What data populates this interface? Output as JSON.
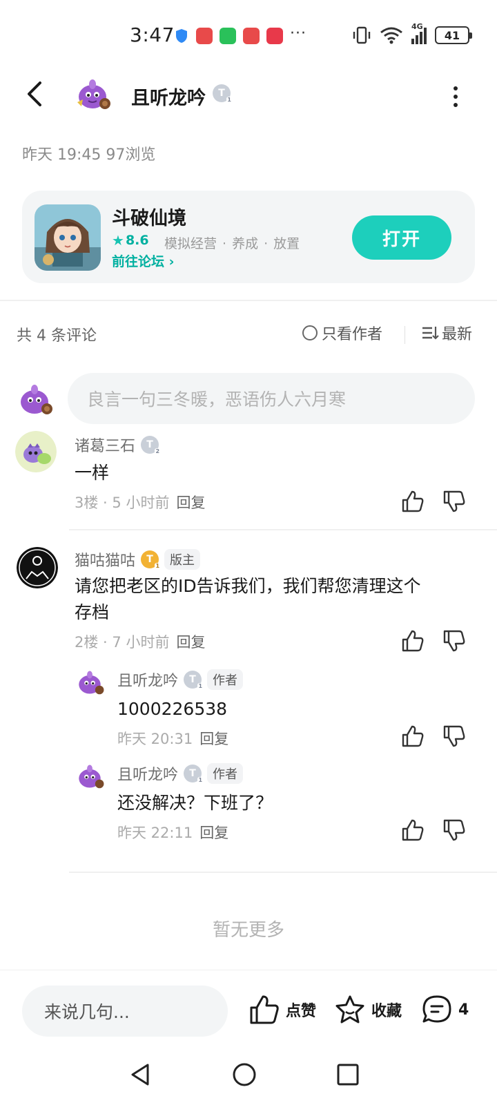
{
  "status_bar": {
    "time": "3:47",
    "battery": "41",
    "network": "4G",
    "more": "···"
  },
  "header": {
    "username": "且听龙吟",
    "level": "T"
  },
  "post_meta": "昨天 19:45  97浏览",
  "app_card": {
    "title": "斗破仙境",
    "rating": "8.6",
    "tags": [
      "模拟经营",
      "养成",
      "放置"
    ],
    "forum_link": "前往论坛",
    "open_label": "打开"
  },
  "comments_header": {
    "count": "共 4 条评论",
    "only_author": "只看作者",
    "sort": "最新"
  },
  "comment_input_placeholder": "良言一句三冬暖，恶语伤人六月寒",
  "comments": [
    {
      "name": "诸葛三石",
      "level": "T",
      "body": "一样",
      "floor": "3楼",
      "time": "5 小时前",
      "reply_label": "回复"
    },
    {
      "name": "猫咕猫咕",
      "level": "T",
      "role": "版主",
      "body_line1": "请您把老区的ID告诉我们，我们帮您清理这个",
      "body_line2": "存档",
      "floor": "2楼",
      "time": "7 小时前",
      "reply_label": "回复",
      "replies": [
        {
          "name": "且听龙吟",
          "level": "T",
          "role": "作者",
          "body": "1000226538",
          "time": "昨天 20:31",
          "reply_label": "回复"
        },
        {
          "name": "且听龙吟",
          "level": "T",
          "role": "作者",
          "body": "还没解决？下班了？",
          "time": "昨天 22:11",
          "reply_label": "回复"
        }
      ]
    }
  ],
  "no_more": "暂无更多",
  "bottom_bar": {
    "input_placeholder": "来说几句...",
    "like_label": "点赞",
    "favorite_label": "收藏",
    "comment_count": "4"
  },
  "colors": {
    "accent": "#1dcfbc",
    "accent_text": "#00b0a0",
    "gold_badge": "#f2b233",
    "silver_badge": "#c9cfd8"
  }
}
